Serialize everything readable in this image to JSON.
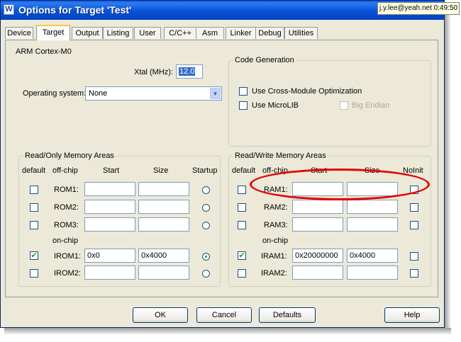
{
  "window": {
    "title": "Options for Target 'Test'",
    "icon": "keil-uvision-icon"
  },
  "tooltip": {
    "text": "j.y.lee@yeah.net 0:49:50"
  },
  "tabs": [
    "Device",
    "Target",
    "Output",
    "Listing",
    "User",
    "C/C++",
    "Asm",
    "Linker",
    "Debug",
    "Utilities"
  ],
  "active_tab": "Target",
  "target": {
    "device_label": "ARM Cortex-M0",
    "xtal_label": "Xtal (MHz):",
    "xtal_value": "12.0",
    "os_label": "Operating system:",
    "os_value": "None"
  },
  "code_generation": {
    "title": "Code Generation",
    "cross_module": "Use Cross-Module Optimization",
    "microlib": "Use MicroLIB",
    "big_endian": "Big Endian"
  },
  "ro_memory": {
    "title": "Read/Only Memory Areas",
    "headers": {
      "default": "default",
      "offchip": "off-chip",
      "start": "Start",
      "size": "Size",
      "startup": "Startup"
    },
    "onchip_label": "on-chip",
    "rows": [
      {
        "name": "ROM1:",
        "start": "",
        "size": "",
        "default": false,
        "startup": false
      },
      {
        "name": "ROM2:",
        "start": "",
        "size": "",
        "default": false,
        "startup": false
      },
      {
        "name": "ROM3:",
        "start": "",
        "size": "",
        "default": false,
        "startup": false
      },
      {
        "name": "IROM1:",
        "start": "0x0",
        "size": "0x4000",
        "default": true,
        "startup": true
      },
      {
        "name": "IROM2:",
        "start": "",
        "size": "",
        "default": false,
        "startup": false
      }
    ]
  },
  "rw_memory": {
    "title": "Read/Write Memory Areas",
    "headers": {
      "default": "default",
      "offchip": "off-chip",
      "start": "Start",
      "size": "Size",
      "noinit": "NoInit"
    },
    "onchip_label": "on-chip",
    "rows": [
      {
        "name": "RAM1:",
        "start": "",
        "size": "",
        "default": false,
        "noinit": false
      },
      {
        "name": "RAM2:",
        "start": "",
        "size": "",
        "default": false,
        "noinit": false
      },
      {
        "name": "RAM3:",
        "start": "",
        "size": "",
        "default": false,
        "noinit": false
      },
      {
        "name": "IRAM1:",
        "start": "0x20000000",
        "size": "0x4000",
        "default": true,
        "noinit": false
      },
      {
        "name": "IRAM2:",
        "start": "",
        "size": "",
        "default": false,
        "noinit": false
      }
    ]
  },
  "buttons": {
    "ok": "OK",
    "cancel": "Cancel",
    "defaults": "Defaults",
    "help": "Help"
  },
  "annotation": {
    "color": "#e30000"
  }
}
